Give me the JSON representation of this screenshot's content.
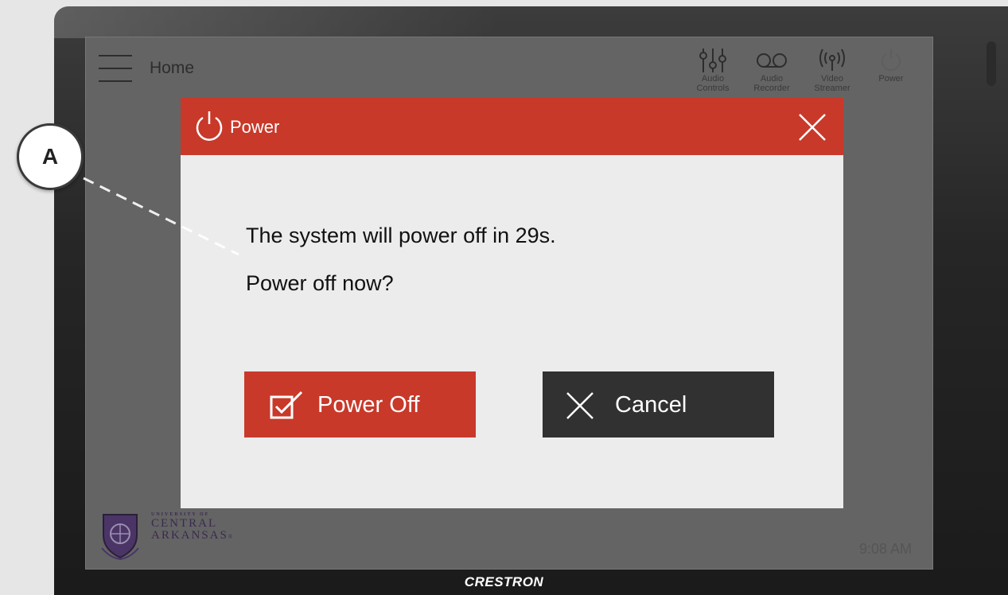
{
  "device": {
    "brand": "CRESTRON"
  },
  "topbar": {
    "title": "Home",
    "menu_icon": "hamburger-icon",
    "icons": [
      {
        "label_line1": "Audio",
        "label_line2": "Controls",
        "icon": "sliders-icon"
      },
      {
        "label_line1": "Audio",
        "label_line2": "Recorder",
        "icon": "voicemail-icon"
      },
      {
        "label_line1": "Video",
        "label_line2": "Streamer",
        "icon": "broadcast-icon"
      },
      {
        "label_line1": "Power",
        "label_line2": "",
        "icon": "power-icon"
      }
    ]
  },
  "dialog": {
    "title": "Power",
    "icon": "power-icon",
    "close_icon": "close-icon",
    "message_line1": "The system will power off in 29s.",
    "message_line2": "Power off now?",
    "confirm_label": "Power Off",
    "confirm_icon": "checkbox-check-icon",
    "cancel_label": "Cancel",
    "cancel_icon": "close-icon"
  },
  "footer": {
    "logo_line1": "UNIVERSITY OF",
    "logo_line2": "CENTRAL",
    "logo_line3": "ARKANSAS",
    "logo_mark": "®",
    "clock": "9:08 AM"
  },
  "callout": {
    "label": "A"
  },
  "colors": {
    "accent": "#c8392a",
    "dark_button": "#313131",
    "screen_bg": "#646464",
    "dialog_bg": "#ececec"
  }
}
